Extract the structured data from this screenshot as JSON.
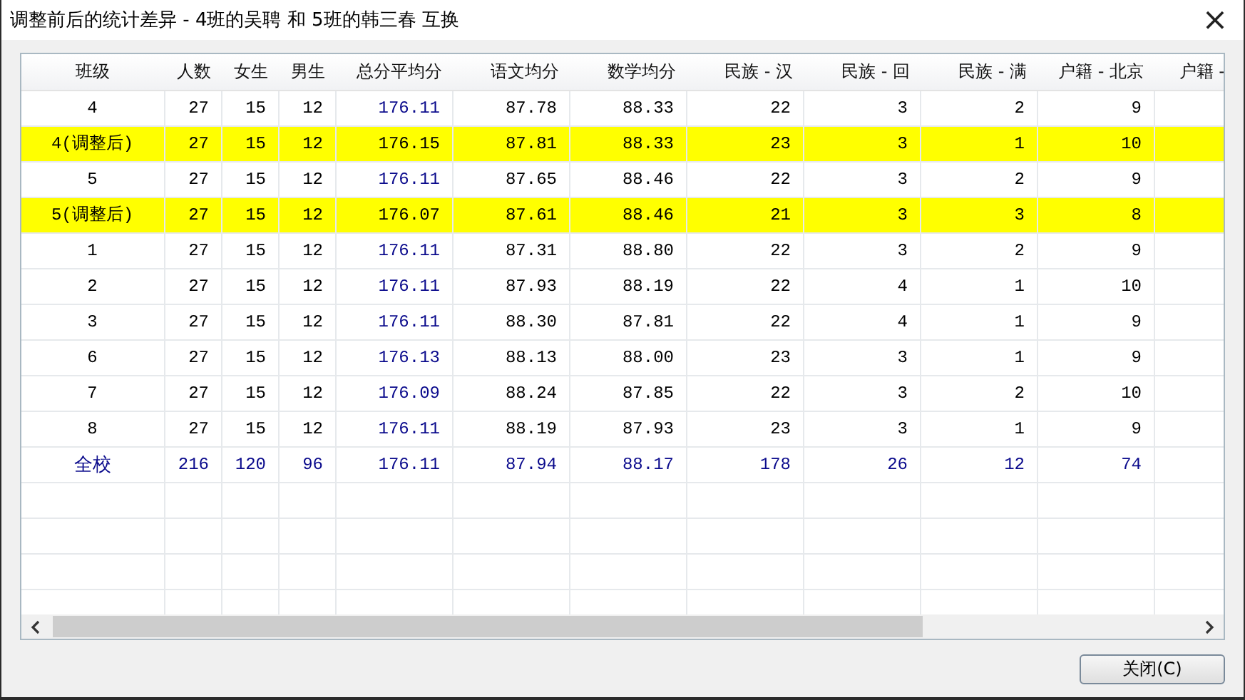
{
  "window": {
    "title": "调整前后的统计差异 - 4班的吴聘 和 5班的韩三春 互换",
    "close": "×"
  },
  "table": {
    "columns": [
      {
        "label": "班级"
      },
      {
        "label": "人数"
      },
      {
        "label": "女生"
      },
      {
        "label": "男生"
      },
      {
        "label": "总分平均分",
        "accent": true
      },
      {
        "label": "语文均分"
      },
      {
        "label": "数学均分"
      },
      {
        "label": "民族 - 汉"
      },
      {
        "label": "民族 - 回"
      },
      {
        "label": "民族 - 满"
      },
      {
        "label": "户籍 - 北京"
      },
      {
        "label": "户籍 -"
      }
    ],
    "rows": [
      {
        "kind": "normal",
        "cells": [
          "4",
          "27",
          "15",
          "12",
          "176.11",
          "87.78",
          "88.33",
          "22",
          "3",
          "2",
          "9"
        ]
      },
      {
        "kind": "adjusted",
        "cells": [
          "4(调整后)",
          "27",
          "15",
          "12",
          "176.15",
          "87.81",
          "88.33",
          "23",
          "3",
          "1",
          "10"
        ]
      },
      {
        "kind": "normal",
        "cells": [
          "5",
          "27",
          "15",
          "12",
          "176.11",
          "87.65",
          "88.46",
          "22",
          "3",
          "2",
          "9"
        ]
      },
      {
        "kind": "adjusted",
        "cells": [
          "5(调整后)",
          "27",
          "15",
          "12",
          "176.07",
          "87.61",
          "88.46",
          "21",
          "3",
          "3",
          "8"
        ]
      },
      {
        "kind": "normal",
        "cells": [
          "1",
          "27",
          "15",
          "12",
          "176.11",
          "87.31",
          "88.80",
          "22",
          "3",
          "2",
          "9"
        ]
      },
      {
        "kind": "normal",
        "cells": [
          "2",
          "27",
          "15",
          "12",
          "176.11",
          "87.93",
          "88.19",
          "22",
          "4",
          "1",
          "10"
        ]
      },
      {
        "kind": "normal",
        "cells": [
          "3",
          "27",
          "15",
          "12",
          "176.11",
          "88.30",
          "87.81",
          "22",
          "4",
          "1",
          "9"
        ]
      },
      {
        "kind": "normal",
        "cells": [
          "6",
          "27",
          "15",
          "12",
          "176.13",
          "88.13",
          "88.00",
          "23",
          "3",
          "1",
          "9"
        ]
      },
      {
        "kind": "normal",
        "cells": [
          "7",
          "27",
          "15",
          "12",
          "176.09",
          "88.24",
          "87.85",
          "22",
          "3",
          "2",
          "10"
        ]
      },
      {
        "kind": "normal",
        "cells": [
          "8",
          "27",
          "15",
          "12",
          "176.11",
          "88.19",
          "87.93",
          "23",
          "3",
          "1",
          "9"
        ]
      },
      {
        "kind": "total",
        "cells": [
          "全校",
          "216",
          "120",
          "96",
          "176.11",
          "87.94",
          "88.17",
          "178",
          "26",
          "12",
          "74"
        ]
      }
    ]
  },
  "buttons": [
    {
      "label": "关闭(C)"
    }
  ]
}
